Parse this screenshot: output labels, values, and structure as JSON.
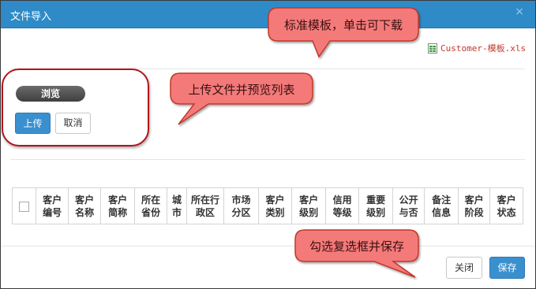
{
  "dialog": {
    "title": "文件导入",
    "close_glyph": "×"
  },
  "template": {
    "icon": "xls-file-icon",
    "filename": "Customer-模板.xls"
  },
  "upload": {
    "browse_label": "浏览",
    "upload_label": "上传",
    "cancel_label": "取消"
  },
  "table": {
    "columns": [
      {
        "label": "客户编号",
        "lines": [
          "客户",
          "编号"
        ]
      },
      {
        "label": "客户名称",
        "lines": [
          "客户",
          "名称"
        ]
      },
      {
        "label": "客户简称",
        "lines": [
          "客户",
          "简称"
        ]
      },
      {
        "label": "所在省份",
        "lines": [
          "所在",
          "省份"
        ]
      },
      {
        "label": "城市",
        "lines": [
          "城",
          "市"
        ]
      },
      {
        "label": "所在行政区",
        "lines": [
          "所在行",
          "政区"
        ]
      },
      {
        "label": "市场分区",
        "lines": [
          "市场",
          "分区"
        ]
      },
      {
        "label": "客户类别",
        "lines": [
          "客户",
          "类别"
        ]
      },
      {
        "label": "客户级别",
        "lines": [
          "客户",
          "级别"
        ]
      },
      {
        "label": "信用等级",
        "lines": [
          "信用",
          "等级"
        ]
      },
      {
        "label": "重要级别",
        "lines": [
          "重要",
          "级别"
        ]
      },
      {
        "label": "公开与否",
        "lines": [
          "公开",
          "与否"
        ]
      },
      {
        "label": "备注信息",
        "lines": [
          "备注",
          "信息"
        ]
      },
      {
        "label": "客户阶段",
        "lines": [
          "客户",
          "阶段"
        ]
      },
      {
        "label": "客户状态",
        "lines": [
          "客户",
          "状态"
        ]
      }
    ]
  },
  "footer": {
    "close_label": "关闭",
    "save_label": "保存"
  },
  "annotations": {
    "template_hint": "标准模板，单击可下载",
    "upload_hint": "上传文件并预览列表",
    "save_hint": "勾选复选框并保存"
  },
  "colors": {
    "titlebar": "#2e8bc7",
    "primary_button": "#3a8fcf",
    "callout_fill": "#f47a7a",
    "callout_border": "#c0392b",
    "link": "#c0392b"
  }
}
